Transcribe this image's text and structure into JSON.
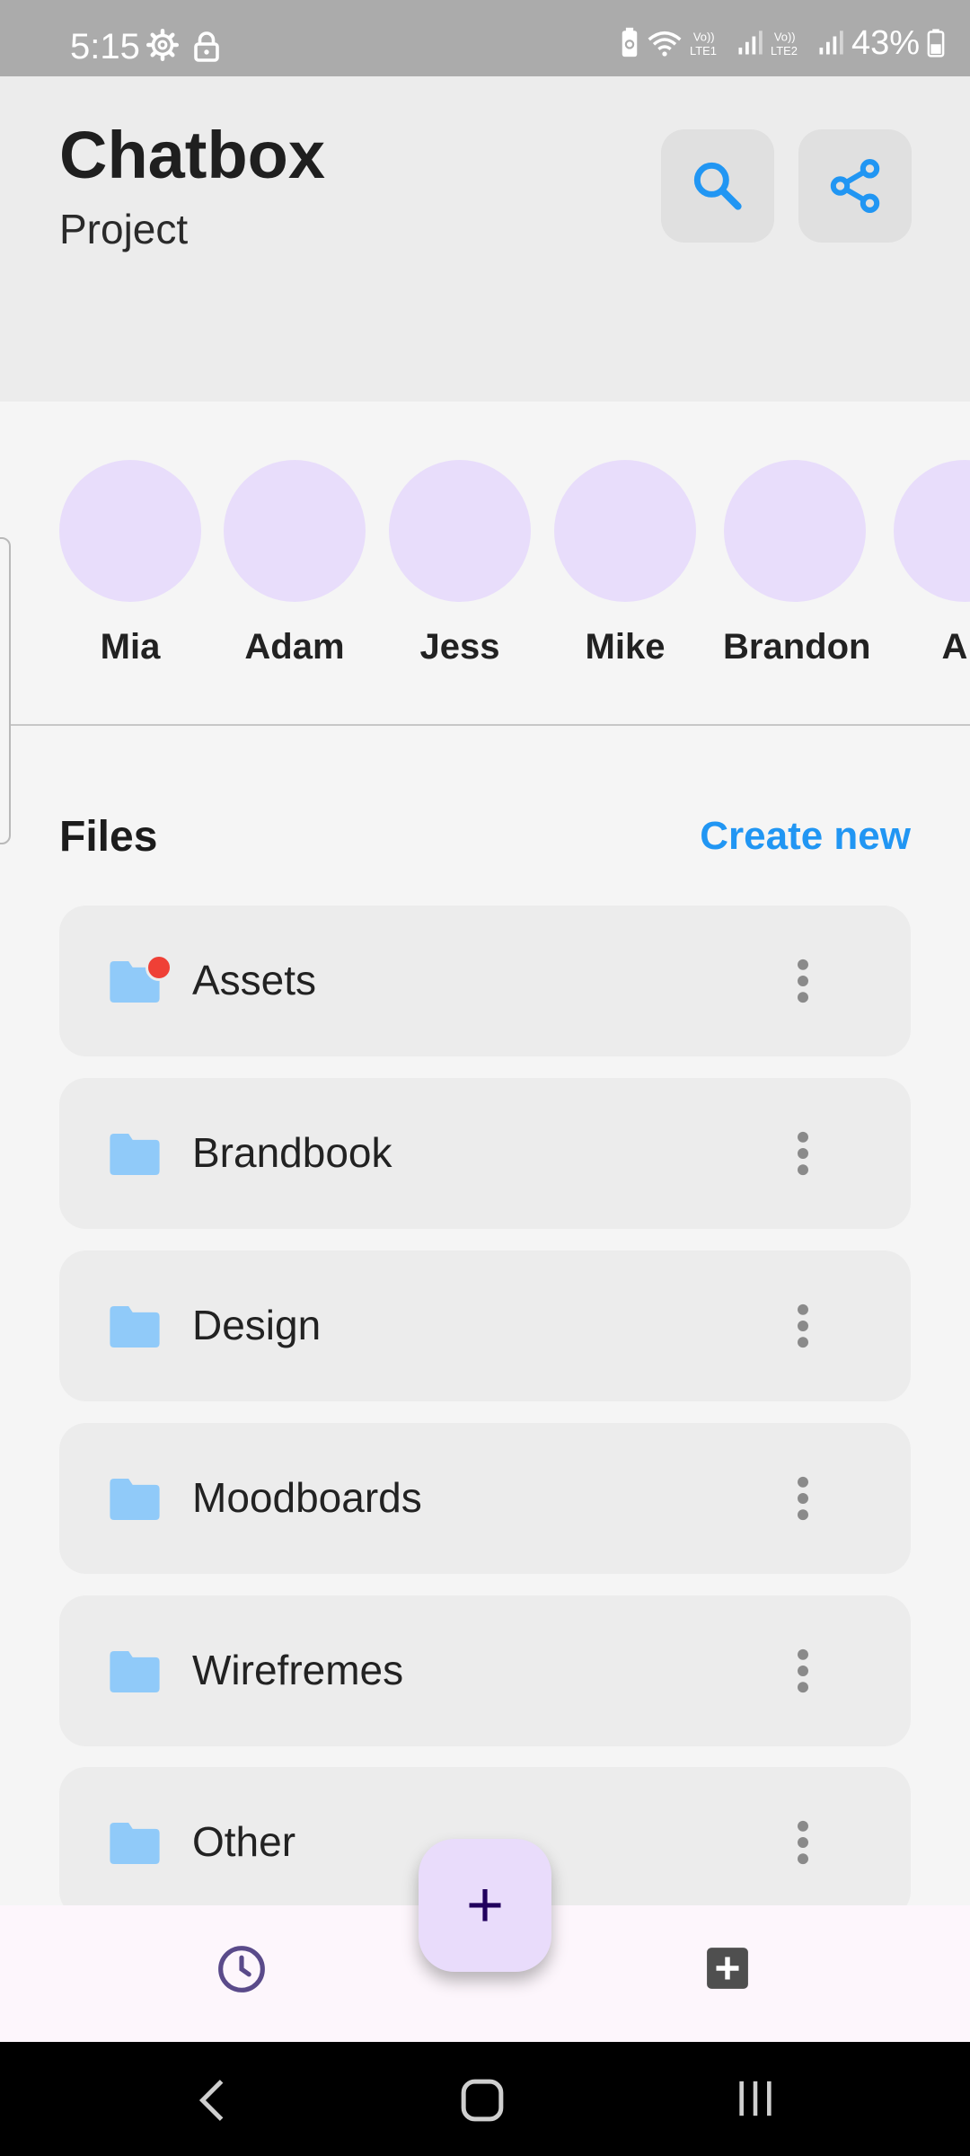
{
  "status_bar": {
    "time": "5:15",
    "battery_percent": "43%",
    "icons": [
      "settings-icon",
      "lock-icon",
      "battery-saver-icon",
      "wifi-icon",
      "volte-lte1-icon",
      "signal-icon",
      "volte-lte2-icon",
      "signal-icon",
      "battery-icon"
    ]
  },
  "header": {
    "title": "Chatbox",
    "subtitle": "Project",
    "actions": [
      "search-icon",
      "share-icon"
    ]
  },
  "people": [
    {
      "name": "Mia"
    },
    {
      "name": "Adam"
    },
    {
      "name": "Jess"
    },
    {
      "name": "Mike"
    },
    {
      "name": "Brandon"
    },
    {
      "name": "Ali"
    }
  ],
  "files": {
    "title": "Files",
    "create_new_label": "Create new",
    "items": [
      {
        "label": "Assets",
        "has_notification": true
      },
      {
        "label": "Brandbook"
      },
      {
        "label": "Design"
      },
      {
        "label": "Moodboards"
      },
      {
        "label": "Wirefremes"
      },
      {
        "label": "Other"
      }
    ]
  },
  "fab": {
    "label": "+"
  },
  "bottom_nav": [
    "clock-icon",
    "add-box-icon"
  ],
  "system_nav": [
    "back-icon",
    "home-icon",
    "recents-icon"
  ],
  "colors": {
    "accent": "#2196f3",
    "avatar_bg": "#e8ddfb",
    "folder": "#90caf9",
    "notification": "#ef4036",
    "fab_bg": "#e9dcfb"
  }
}
